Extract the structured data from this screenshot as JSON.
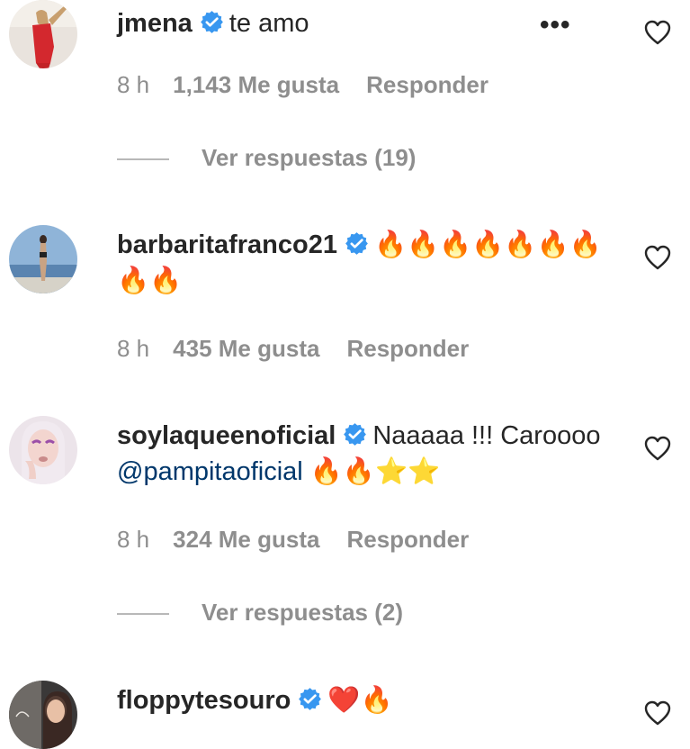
{
  "comments": [
    {
      "username": "jmena",
      "text": "te amo",
      "time": "8 h",
      "likes": "1,143 Me gusta",
      "reply": "Responder",
      "more": "•••",
      "view_replies": "Ver respuestas (19)"
    },
    {
      "username": "barbaritafranco21",
      "text": "🔥🔥🔥🔥🔥🔥🔥🔥🔥",
      "time": "8 h",
      "likes": "435 Me gusta",
      "reply": "Responder"
    },
    {
      "username": "soylaqueenoficial",
      "text_before": "Naaaaa !!! Caroooo",
      "mention": "@pampitaoficial",
      "text_after": "🔥🔥⭐⭐",
      "time": "8 h",
      "likes": "324 Me gusta",
      "reply": "Responder",
      "view_replies": "Ver respuestas (2)"
    },
    {
      "username": "floppytesouro",
      "text": "❤️🔥"
    }
  ],
  "colors": {
    "text": "#262626",
    "meta": "#8e8e8e",
    "verified": "#3897f0",
    "mention": "#00376b"
  },
  "icons": {
    "verified": "verified-badge-icon",
    "like": "heart-outline-icon",
    "options": "more-options-icon"
  }
}
